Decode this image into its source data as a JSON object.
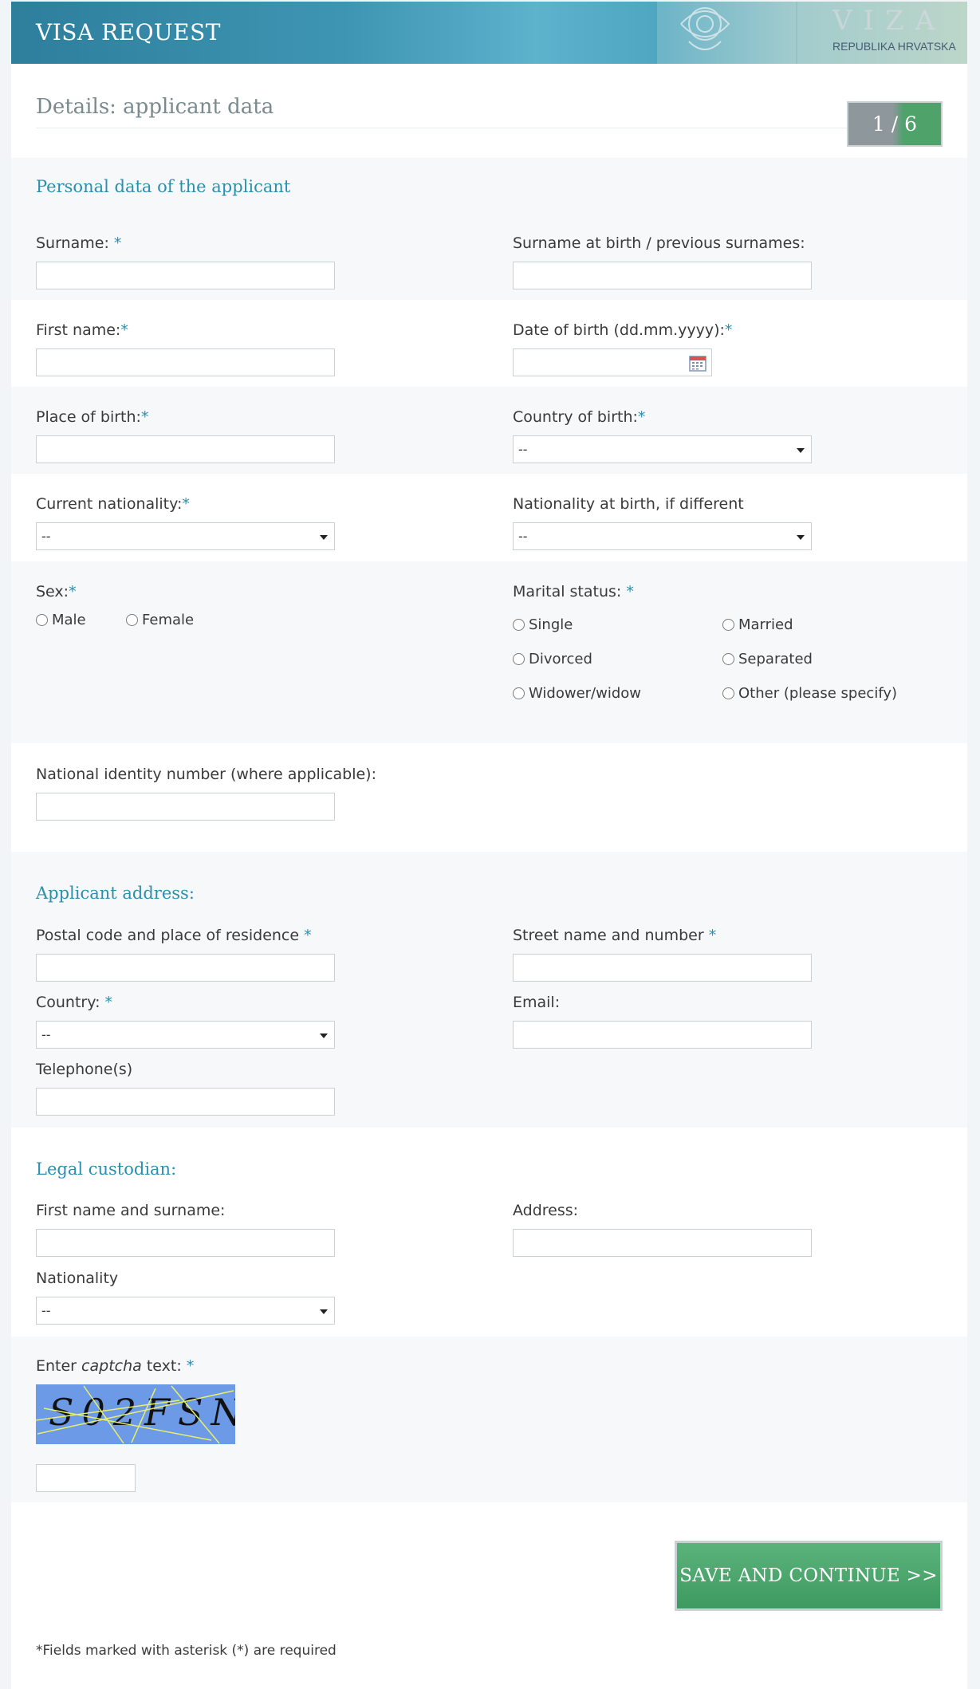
{
  "header": {
    "title": "VISA REQUEST",
    "stamp_text": "VIZA",
    "stamp_sub": "REPUBLIKA HRVATSKA"
  },
  "page": {
    "title": "Details: applicant data",
    "step": "1 / 6"
  },
  "personal": {
    "section_title": "Personal data of the applicant",
    "surname": {
      "label": "Surname: ",
      "req": "*",
      "value": ""
    },
    "surname_birth": {
      "label": "Surname at birth / previous surnames:",
      "value": ""
    },
    "first_name": {
      "label": "First name:",
      "req": "*",
      "value": ""
    },
    "dob": {
      "label": "Date of birth (dd.mm.yyyy):",
      "req": "*",
      "value": ""
    },
    "place_birth": {
      "label": "Place of birth:",
      "req": "*",
      "value": ""
    },
    "country_birth": {
      "label": "Country of birth:",
      "req": "*",
      "selected": "--"
    },
    "current_nationality": {
      "label": "Current nationality:",
      "req": "*",
      "selected": "--"
    },
    "nationality_birth": {
      "label": "Nationality at birth, if different",
      "selected": "--"
    },
    "sex": {
      "label": "Sex:",
      "req": "*",
      "options": [
        "Male",
        "Female"
      ]
    },
    "marital": {
      "label": "Marital status: ",
      "req": "*",
      "options": [
        "Single",
        "Married",
        "Divorced",
        "Separated",
        "Widower/widow",
        "Other (please specify)"
      ]
    },
    "national_id": {
      "label": "National identity number (where applicable):",
      "value": ""
    }
  },
  "address": {
    "section_title": "Applicant address:",
    "postal": {
      "label": "Postal code and place of residence ",
      "req": "*",
      "value": ""
    },
    "street": {
      "label": "Street name and number ",
      "req": "*",
      "value": ""
    },
    "country": {
      "label": "Country: ",
      "req": "*",
      "selected": "--"
    },
    "email": {
      "label": "Email:",
      "value": ""
    },
    "telephone": {
      "label": "Telephone(s)",
      "value": ""
    }
  },
  "custodian": {
    "section_title": "Legal custodian:",
    "name": {
      "label": "First name and surname:",
      "value": ""
    },
    "address": {
      "label": "Address:",
      "value": ""
    },
    "nationality": {
      "label": "Nationality",
      "selected": "--"
    }
  },
  "captcha": {
    "label_pre": "Enter ",
    "label_em": "captcha",
    "label_post": " text: ",
    "req": "*",
    "image_text": "S02FSN",
    "value": ""
  },
  "actions": {
    "save_label": "SAVE AND CONTINUE >>"
  },
  "footer": {
    "note": "*Fields marked with asterisk (*) are required"
  },
  "colors": {
    "accent": "#2b8fae",
    "button": "#4ea26a",
    "header": "#3e95b3"
  }
}
